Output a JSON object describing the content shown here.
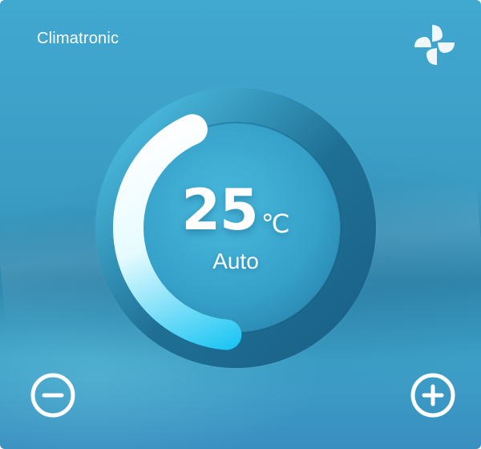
{
  "app": {
    "title": "Climatronic"
  },
  "thermostat": {
    "temperature": "25",
    "unit": "℃",
    "mode": "Auto",
    "level": 0.42
  },
  "icons": {
    "fan": "fan-icon",
    "minus": "minus-circle-icon",
    "plus": "plus-circle-icon"
  },
  "colors": {
    "background": "#3a9bc2",
    "ring_dark": "#1f6e93",
    "ring_light": "#4dc0e8",
    "arc_start": "#ffffff",
    "arc_end": "#1fc6f3",
    "text": "#ffffff"
  }
}
